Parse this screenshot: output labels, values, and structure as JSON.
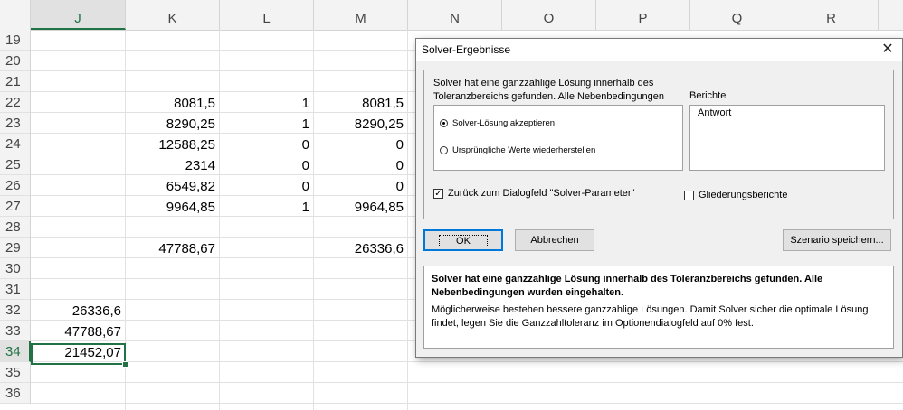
{
  "sheet": {
    "columns": [
      "J",
      "K",
      "L",
      "M",
      "N",
      "O",
      "P",
      "Q",
      "R"
    ],
    "rows": [
      "19",
      "20",
      "21",
      "22",
      "23",
      "24",
      "25",
      "26",
      "27",
      "28",
      "29",
      "30",
      "31",
      "32",
      "33",
      "34",
      "35",
      "36"
    ],
    "cells": {
      "K22": "8081,5",
      "L22": "1",
      "M22": "8081,5",
      "K23": "8290,25",
      "L23": "1",
      "M23": "8290,25",
      "K24": "12588,25",
      "L24": "0",
      "M24": "0",
      "K25": "2314",
      "L25": "0",
      "M25": "0",
      "K26": "6549,82",
      "L26": "0",
      "M26": "0",
      "K27": "9964,85",
      "L27": "1",
      "M27": "9964,85",
      "K29": "47788,67",
      "M29": "26336,6",
      "J32": "26336,6",
      "J33": "47788,67",
      "J34": "21452,07"
    },
    "selected_cell": "J34",
    "accent_color": "#217346"
  },
  "dialog": {
    "title": "Solver-Ergebnisse",
    "close_icon": "close-icon",
    "message": "Solver hat eine ganzzahlige Lösung innerhalb des Toleranzbereichs gefunden. Alle Nebenbedingungen",
    "options": {
      "keep_label": "Solver-Lösung akzeptieren",
      "restore_label": "Ursprüngliche Werte wiederherstellen",
      "selected": "keep"
    },
    "reports": {
      "label": "Berichte",
      "items": [
        "Antwort"
      ]
    },
    "return_label": "Zurück zum Dialogfeld \"Solver-Parameter\"",
    "return_checked": true,
    "outline_label": "Gliederungsberichte",
    "outline_checked": false,
    "buttons": {
      "ok": "OK",
      "cancel": "Abbrechen",
      "save_scenario": "Szenario speichern..."
    },
    "info_bold": "Solver hat eine ganzzahlige Lösung innerhalb des Toleranzbereichs gefunden. Alle Nebenbedingungen wurden eingehalten.",
    "info_text": "Möglicherweise bestehen bessere ganzzahlige Lösungen. Damit Solver sicher die optimale Lösung findet, legen Sie die Ganzzahltoleranz im Optionendialogfeld auf 0% fest."
  }
}
